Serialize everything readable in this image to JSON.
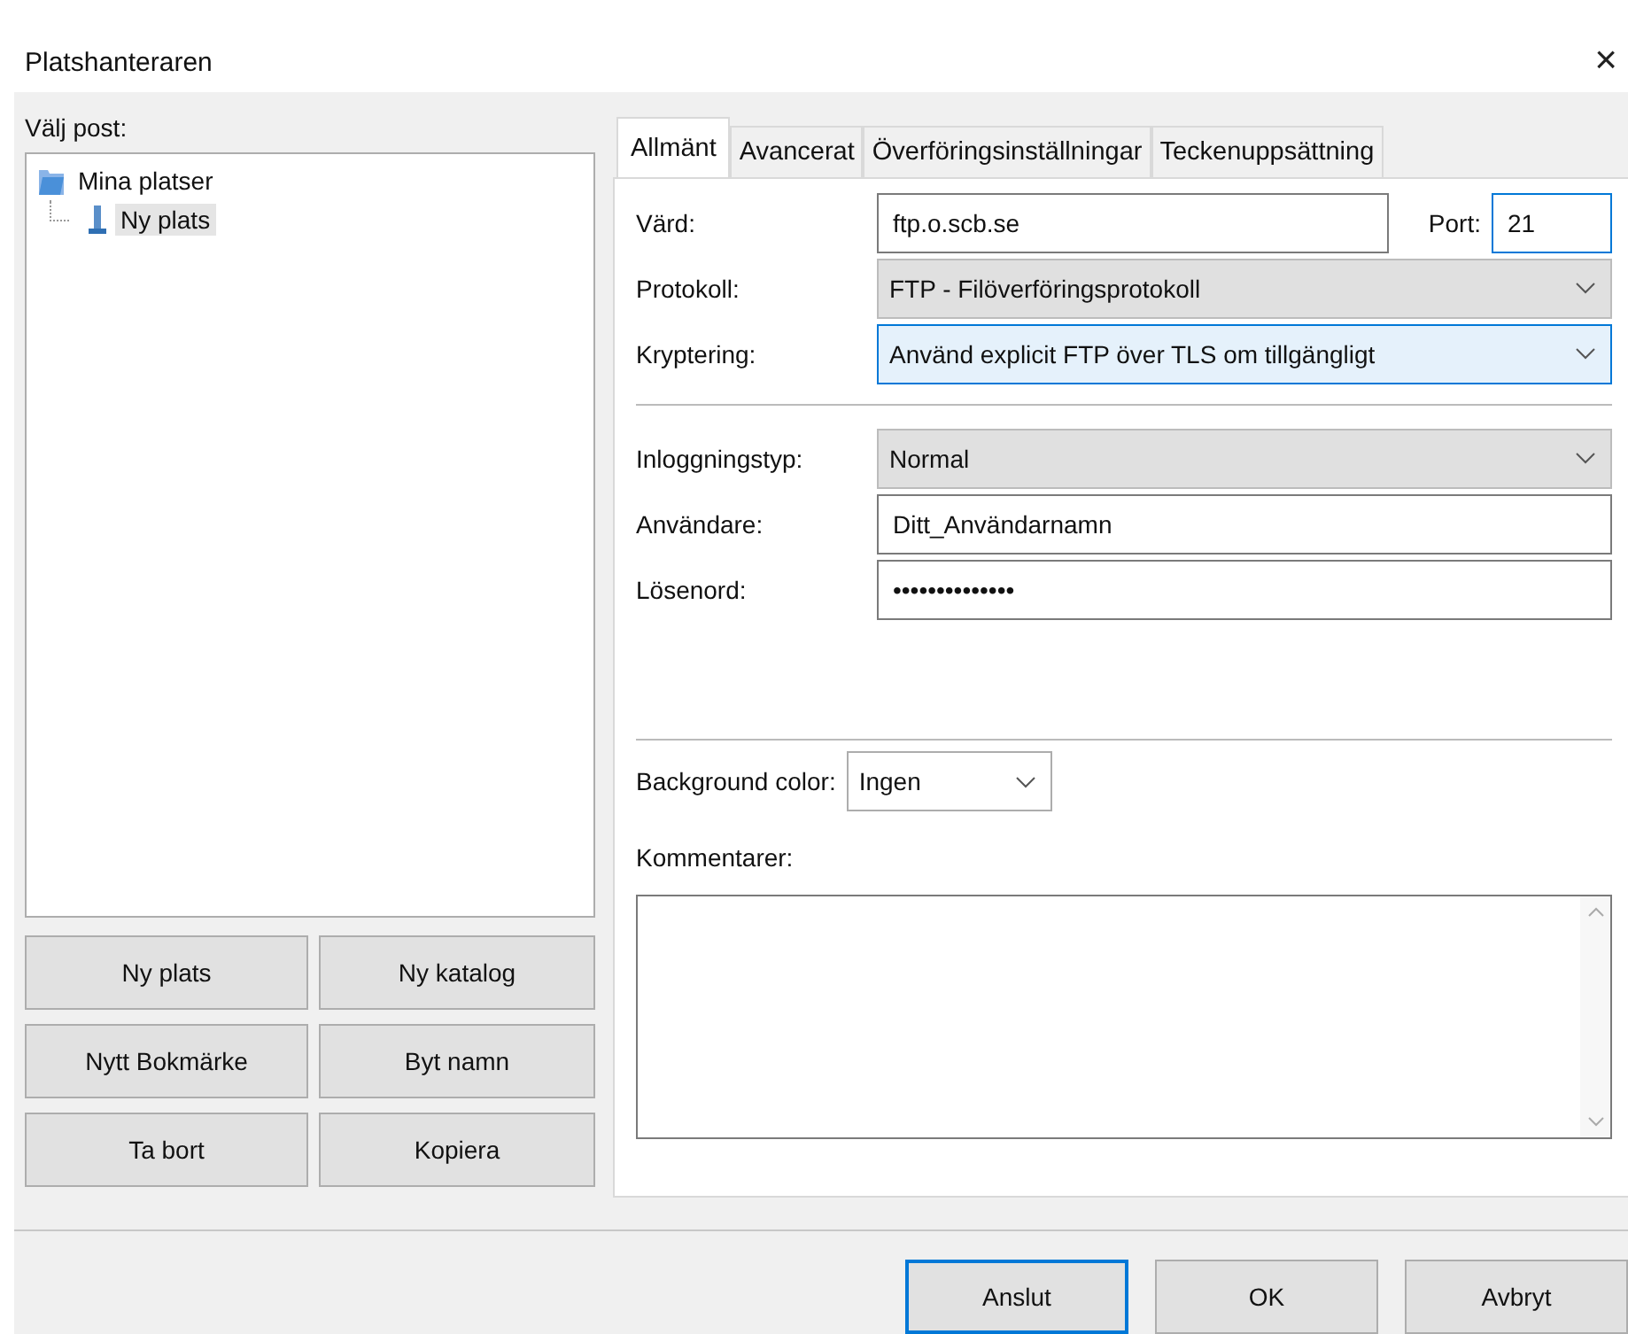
{
  "window": {
    "title": "Platshanteraren",
    "close": "×"
  },
  "left": {
    "label": "Välj post:",
    "tree": [
      {
        "label": "Mina platser",
        "kind": "folder",
        "selected": false,
        "children": [
          {
            "label": "Ny plats",
            "kind": "site",
            "selected": true
          }
        ]
      }
    ],
    "buttons": [
      {
        "label": "Ny plats"
      },
      {
        "label": "Ny katalog"
      },
      {
        "label": "Nytt Bokmärke"
      },
      {
        "label": "Byt namn"
      },
      {
        "label": "Ta bort"
      },
      {
        "label": "Kopiera"
      }
    ]
  },
  "tabs": [
    {
      "label": "Allmänt",
      "selected": true
    },
    {
      "label": "Avancerat",
      "selected": false
    },
    {
      "label": "Överföringsinställningar",
      "selected": false
    },
    {
      "label": "Teckenuppsättning",
      "selected": false
    }
  ],
  "host": {
    "label": "Värd:",
    "value": "ftp.o.scb.se",
    "focused": false
  },
  "port": {
    "label": "Port:",
    "value": "21",
    "focused": true
  },
  "protocol": {
    "label": "Protokoll:",
    "value": "FTP - Filöverföringsprotokoll",
    "focused": false
  },
  "encryption": {
    "label": "Kryptering:",
    "value": "Använd explicit FTP över TLS om tillgängligt",
    "focused": true
  },
  "logon_type": {
    "label": "Inloggningstyp:",
    "value": "Normal",
    "focused": false
  },
  "user": {
    "label": "Användare:",
    "value": "Ditt_Användarnamn",
    "focused": false
  },
  "password": {
    "label": "Lösenord:",
    "value": "••••••••••••••",
    "focused": false
  },
  "background_color": {
    "label": "Background color:",
    "value": "Ingen"
  },
  "comments": {
    "label": "Kommentarer:"
  },
  "footer_buttons": [
    {
      "label": "Anslut",
      "default": true
    },
    {
      "label": "OK",
      "default": false
    },
    {
      "label": "Avbryt",
      "default": false
    }
  ]
}
